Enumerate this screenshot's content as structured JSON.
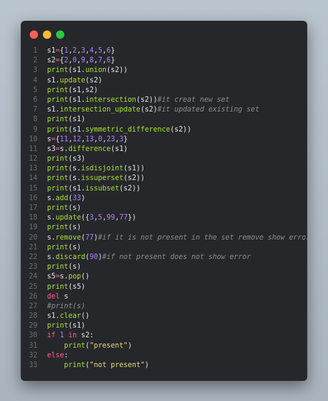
{
  "colors": {
    "window_bg": "#26272b",
    "red": "#fe5f57",
    "yellow": "#febc2e",
    "green": "#28c840",
    "line_number": "#6b6e76",
    "plain": "#e6e6e6",
    "keyword": "#ff5f8f",
    "function": "#a6e22e",
    "number": "#ae81ff",
    "string": "#e6db74",
    "comment": "#8a8c93"
  },
  "window_controls": [
    {
      "name": "close",
      "icon": "red-dot"
    },
    {
      "name": "minimize",
      "icon": "yellow-dot"
    },
    {
      "name": "zoom",
      "icon": "green-dot"
    }
  ],
  "code": {
    "lines": [
      {
        "n": "1",
        "tokens": [
          [
            "pl",
            "s1"
          ],
          [
            "op",
            "="
          ],
          [
            "pl",
            "{"
          ],
          [
            "num",
            "1"
          ],
          [
            "pl",
            ","
          ],
          [
            "num",
            "2"
          ],
          [
            "pl",
            ","
          ],
          [
            "num",
            "3"
          ],
          [
            "pl",
            ","
          ],
          [
            "num",
            "4"
          ],
          [
            "pl",
            ","
          ],
          [
            "num",
            "5"
          ],
          [
            "pl",
            ","
          ],
          [
            "num",
            "6"
          ],
          [
            "pl",
            "}"
          ]
        ]
      },
      {
        "n": "2",
        "tokens": [
          [
            "pl",
            "s2"
          ],
          [
            "op",
            "="
          ],
          [
            "pl",
            "{"
          ],
          [
            "num",
            "2"
          ],
          [
            "pl",
            ","
          ],
          [
            "num",
            "0"
          ],
          [
            "pl",
            ","
          ],
          [
            "num",
            "9"
          ],
          [
            "pl",
            ","
          ],
          [
            "num",
            "8"
          ],
          [
            "pl",
            ","
          ],
          [
            "num",
            "7"
          ],
          [
            "pl",
            ","
          ],
          [
            "num",
            "6"
          ],
          [
            "pl",
            "}"
          ]
        ]
      },
      {
        "n": "3",
        "tokens": [
          [
            "fn",
            "print"
          ],
          [
            "pl",
            "(s1."
          ],
          [
            "fn",
            "union"
          ],
          [
            "pl",
            "(s2))"
          ]
        ]
      },
      {
        "n": "4",
        "tokens": [
          [
            "pl",
            "s1."
          ],
          [
            "fn",
            "update"
          ],
          [
            "pl",
            "(s2)"
          ]
        ]
      },
      {
        "n": "5",
        "tokens": [
          [
            "fn",
            "print"
          ],
          [
            "pl",
            "(s1,s2)"
          ]
        ]
      },
      {
        "n": "6",
        "tokens": [
          [
            "fn",
            "print"
          ],
          [
            "pl",
            "(s1."
          ],
          [
            "fn",
            "intersection"
          ],
          [
            "pl",
            "(s2))"
          ],
          [
            "com",
            "#it creat new set"
          ]
        ]
      },
      {
        "n": "7",
        "tokens": [
          [
            "pl",
            "s1."
          ],
          [
            "fn",
            "intersection_update"
          ],
          [
            "pl",
            "(s2)"
          ],
          [
            "com",
            "#it updated existing set"
          ]
        ]
      },
      {
        "n": "8",
        "tokens": [
          [
            "fn",
            "print"
          ],
          [
            "pl",
            "(s1)"
          ]
        ]
      },
      {
        "n": "9",
        "tokens": [
          [
            "fn",
            "print"
          ],
          [
            "pl",
            "(s1."
          ],
          [
            "fn",
            "symmetric_difference"
          ],
          [
            "pl",
            "(s2))"
          ]
        ]
      },
      {
        "n": "10",
        "tokens": [
          [
            "pl",
            "s"
          ],
          [
            "op",
            "="
          ],
          [
            "pl",
            "{"
          ],
          [
            "num",
            "11"
          ],
          [
            "pl",
            ","
          ],
          [
            "num",
            "12"
          ],
          [
            "pl",
            ","
          ],
          [
            "num",
            "13"
          ],
          [
            "pl",
            ","
          ],
          [
            "num",
            "0"
          ],
          [
            "pl",
            ","
          ],
          [
            "num",
            "23"
          ],
          [
            "pl",
            ","
          ],
          [
            "num",
            "3"
          ],
          [
            "pl",
            "}"
          ]
        ]
      },
      {
        "n": "11",
        "tokens": [
          [
            "pl",
            "s3"
          ],
          [
            "op",
            "="
          ],
          [
            "pl",
            "s."
          ],
          [
            "fn",
            "difference"
          ],
          [
            "pl",
            "(s1)"
          ]
        ]
      },
      {
        "n": "12",
        "tokens": [
          [
            "fn",
            "print"
          ],
          [
            "pl",
            "(s3)"
          ]
        ]
      },
      {
        "n": "13",
        "tokens": [
          [
            "fn",
            "print"
          ],
          [
            "pl",
            "(s."
          ],
          [
            "fn",
            "isdisjoint"
          ],
          [
            "pl",
            "(s1))"
          ]
        ]
      },
      {
        "n": "14",
        "tokens": [
          [
            "fn",
            "print"
          ],
          [
            "pl",
            "(s."
          ],
          [
            "fn",
            "issuperset"
          ],
          [
            "pl",
            "(s2))"
          ]
        ]
      },
      {
        "n": "15",
        "tokens": [
          [
            "fn",
            "print"
          ],
          [
            "pl",
            "(s1."
          ],
          [
            "fn",
            "issubset"
          ],
          [
            "pl",
            "(s2))"
          ]
        ]
      },
      {
        "n": "16",
        "tokens": [
          [
            "pl",
            "s."
          ],
          [
            "fn",
            "add"
          ],
          [
            "pl",
            "("
          ],
          [
            "num",
            "33"
          ],
          [
            "pl",
            ")"
          ]
        ]
      },
      {
        "n": "17",
        "tokens": [
          [
            "fn",
            "print"
          ],
          [
            "pl",
            "(s)"
          ]
        ]
      },
      {
        "n": "18",
        "tokens": [
          [
            "pl",
            "s."
          ],
          [
            "fn",
            "update"
          ],
          [
            "pl",
            "({"
          ],
          [
            "num",
            "3"
          ],
          [
            "pl",
            ","
          ],
          [
            "num",
            "5"
          ],
          [
            "pl",
            ","
          ],
          [
            "num",
            "99"
          ],
          [
            "pl",
            ","
          ],
          [
            "num",
            "77"
          ],
          [
            "pl",
            "})"
          ]
        ]
      },
      {
        "n": "19",
        "tokens": [
          [
            "fn",
            "print"
          ],
          [
            "pl",
            "(s)"
          ]
        ]
      },
      {
        "n": "20",
        "tokens": [
          [
            "pl",
            "s."
          ],
          [
            "fn",
            "remove"
          ],
          [
            "pl",
            "("
          ],
          [
            "num",
            "77"
          ],
          [
            "pl",
            ")"
          ],
          [
            "com",
            "#if it is not present in the set remove show error"
          ]
        ]
      },
      {
        "n": "21",
        "tokens": [
          [
            "fn",
            "print"
          ],
          [
            "pl",
            "(s)"
          ]
        ]
      },
      {
        "n": "22",
        "tokens": [
          [
            "pl",
            "s."
          ],
          [
            "fn",
            "discard"
          ],
          [
            "pl",
            "("
          ],
          [
            "num",
            "90"
          ],
          [
            "pl",
            ")"
          ],
          [
            "com",
            "#if not present does not show error"
          ]
        ]
      },
      {
        "n": "23",
        "tokens": [
          [
            "fn",
            "print"
          ],
          [
            "pl",
            "(s)"
          ]
        ]
      },
      {
        "n": "24",
        "tokens": [
          [
            "pl",
            "s5"
          ],
          [
            "op",
            "="
          ],
          [
            "pl",
            "s."
          ],
          [
            "fn",
            "pop"
          ],
          [
            "pl",
            "()"
          ]
        ]
      },
      {
        "n": "25",
        "tokens": [
          [
            "fn",
            "print"
          ],
          [
            "pl",
            "(s5)"
          ]
        ]
      },
      {
        "n": "26",
        "tokens": [
          [
            "kw",
            "del"
          ],
          [
            "pl",
            " s"
          ]
        ]
      },
      {
        "n": "27",
        "tokens": [
          [
            "com",
            "#print(s)"
          ]
        ]
      },
      {
        "n": "28",
        "tokens": [
          [
            "pl",
            "s1."
          ],
          [
            "fn",
            "clear"
          ],
          [
            "pl",
            "()"
          ]
        ]
      },
      {
        "n": "29",
        "tokens": [
          [
            "fn",
            "print"
          ],
          [
            "pl",
            "(s1)"
          ]
        ]
      },
      {
        "n": "30",
        "tokens": [
          [
            "kw",
            "if"
          ],
          [
            "pl",
            " "
          ],
          [
            "num",
            "1"
          ],
          [
            "pl",
            " "
          ],
          [
            "kw",
            "in"
          ],
          [
            "pl",
            " s2:"
          ]
        ]
      },
      {
        "n": "31",
        "tokens": [
          [
            "pl",
            "    "
          ],
          [
            "fn",
            "print"
          ],
          [
            "pl",
            "("
          ],
          [
            "str",
            "\"present\""
          ],
          [
            "pl",
            ")"
          ]
        ]
      },
      {
        "n": "32",
        "tokens": [
          [
            "kw",
            "else"
          ],
          [
            "pl",
            ":"
          ]
        ]
      },
      {
        "n": "33",
        "tokens": [
          [
            "pl",
            "    "
          ],
          [
            "fn",
            "print"
          ],
          [
            "pl",
            "("
          ],
          [
            "str",
            "\"not present\""
          ],
          [
            "pl",
            ")"
          ]
        ]
      }
    ]
  }
}
